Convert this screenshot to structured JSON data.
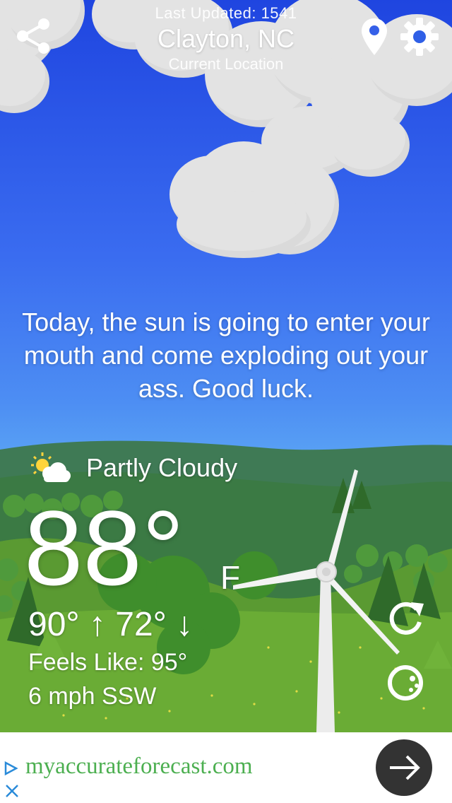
{
  "header": {
    "last_updated": "Last Updated: 1541",
    "city": "Clayton, NC",
    "subtitle": "Current Location"
  },
  "icons": {
    "share": "share-icon",
    "location": "map-pin-icon",
    "settings": "gear-icon",
    "condition": "partly-cloudy-icon",
    "refresh": "refresh-icon",
    "theme": "moon-toggle-icon"
  },
  "forecast": {
    "quote": "Today, the sun is going to enter your mouth and come exploding out your ass. Good luck."
  },
  "current": {
    "condition": "Partly Cloudy",
    "temperature": "88°",
    "unit": "F",
    "high": "90°",
    "low": "72°",
    "hilo": "90° ↑ 72° ↓",
    "feels_like": "Feels Like: 95°",
    "wind": "6 mph SSW"
  },
  "ad": {
    "url": "myaccurateforecast.com",
    "url_color": "#4caf50"
  },
  "colors": {
    "sky_top": "#1f45e0",
    "sky_bottom": "#5aa3f4",
    "grass": "#5a9a32",
    "cloud": "#e3e3e3"
  }
}
